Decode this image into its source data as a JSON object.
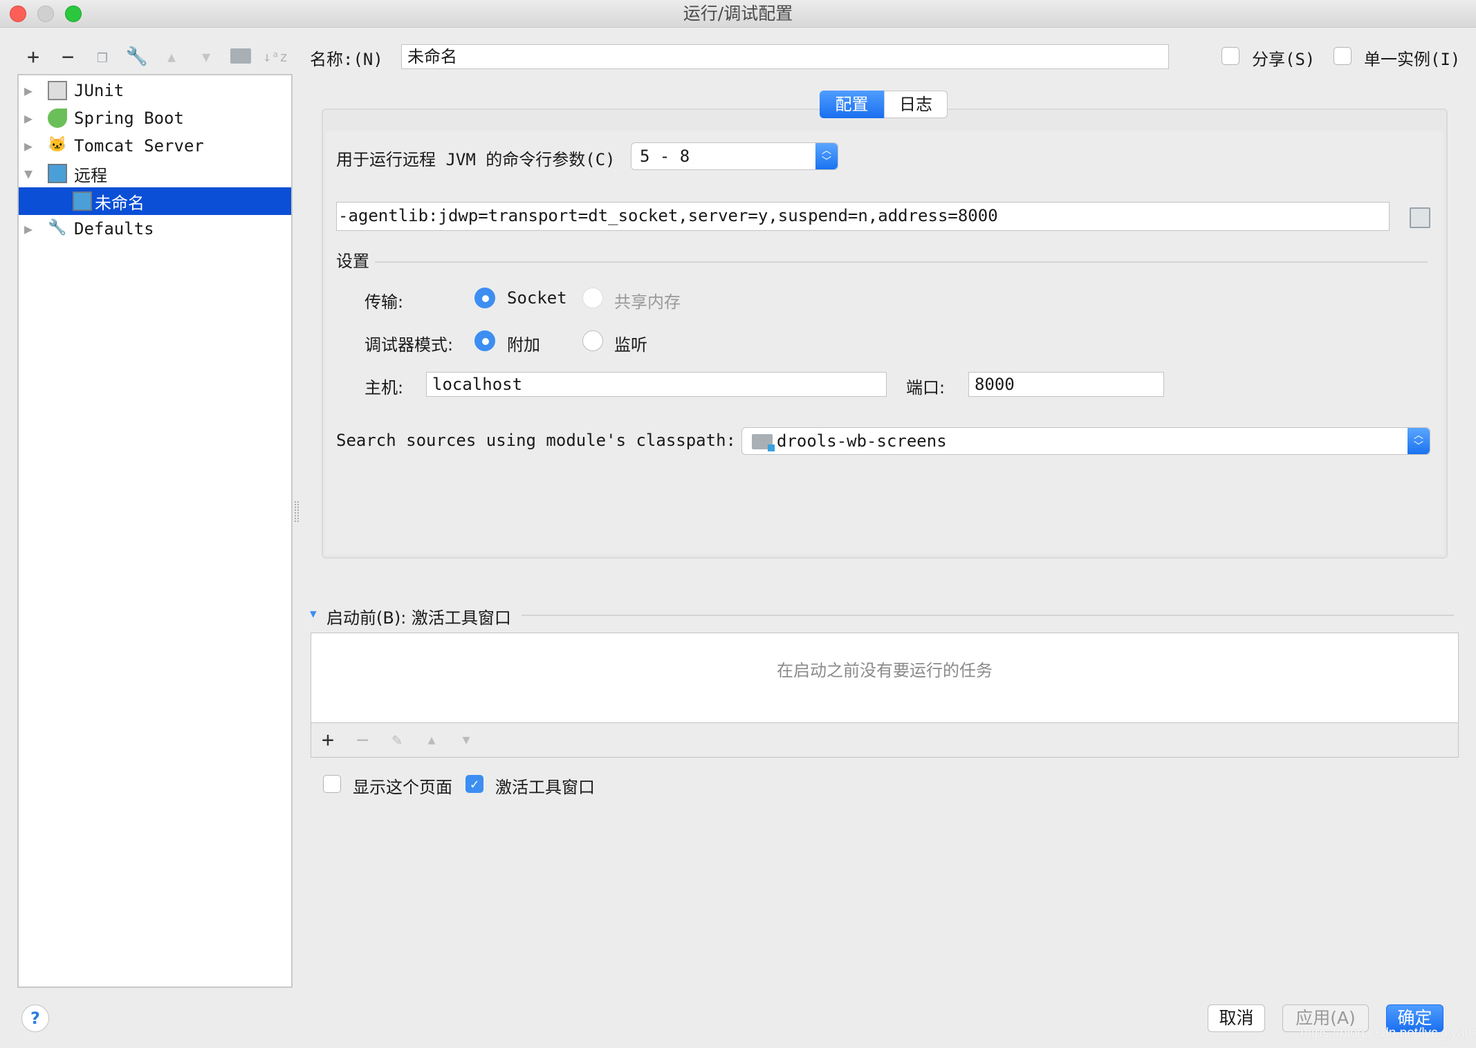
{
  "window": {
    "title": "运行/调试配置"
  },
  "toolbar": {
    "icons": [
      "plus-icon",
      "minus-icon",
      "copy-icon",
      "wrench-icon",
      "arrow-up-icon",
      "arrow-down-icon",
      "folder-icon",
      "sort-az-icon"
    ]
  },
  "tree": {
    "items": [
      {
        "label": "JUnit",
        "expanded": false
      },
      {
        "label": "Spring Boot",
        "expanded": false
      },
      {
        "label": "Tomcat Server",
        "expanded": false
      },
      {
        "label": "远程",
        "expanded": true
      },
      {
        "label": "未命名",
        "selected": true
      },
      {
        "label": "Defaults",
        "expanded": false
      }
    ]
  },
  "header": {
    "name_label": "名称:(N)",
    "name_value": "未命名",
    "share_label": "分享(S)",
    "share_checked": false,
    "single_label": "单一实例(I)",
    "single_checked": false
  },
  "tabs": [
    {
      "label": "配置",
      "active": true
    },
    {
      "label": "日志",
      "active": false
    }
  ],
  "config": {
    "jvm_label": "用于运行远程 JVM 的命令行参数(C)",
    "jvm_version": "5 - 8",
    "command": "-agentlib:jdwp=transport=dt_socket,server=y,suspend=n,address=8000",
    "settings_label": "设置",
    "transport_label": "传输:",
    "transport_options": [
      {
        "label": "Socket",
        "selected": true
      },
      {
        "label": "共享内存",
        "selected": false,
        "disabled": true
      }
    ],
    "mode_label": "调试器模式:",
    "mode_options": [
      {
        "label": "附加",
        "selected": true
      },
      {
        "label": "监听",
        "selected": false
      }
    ],
    "host_label": "主机:",
    "host_value": "localhost",
    "port_label": "端口:",
    "port_value": "8000",
    "module_label": "Search sources using module's classpath:",
    "module_value": "drools-wb-screens"
  },
  "before_launch": {
    "label": "启动前(B): 激活工具窗口",
    "empty_text": "在启动之前没有要运行的任务"
  },
  "options": {
    "show_page_label": "显示这个页面",
    "show_page_checked": false,
    "activate_label": "激活工具窗口",
    "activate_checked": true
  },
  "footer": {
    "help": "?",
    "cancel": "取消",
    "apply": "应用(A)",
    "ok": "确定"
  },
  "watermark": "https://blog.csdn.net/lyc_liyanchao",
  "colors": {
    "accent": "#1a73f0",
    "selection": "#0a4fd6"
  }
}
